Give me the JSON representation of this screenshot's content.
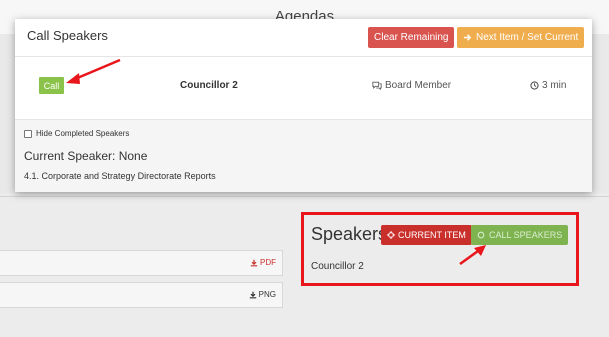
{
  "background": {
    "title": "Agendas",
    "files": [
      {
        "label": "PDF",
        "icon": "download-icon"
      },
      {
        "label": "PNG",
        "icon": "download-icon"
      }
    ]
  },
  "speakers_panel": {
    "title": "Speakers",
    "current_item_label": "CURRENT ITEM",
    "call_speakers_label": "CALL SPEAKERS",
    "speaker_name": "Councillor 2"
  },
  "modal": {
    "title": "Call Speakers",
    "clear_label": "Clear Remaining",
    "next_label": "Next Item / Set Current",
    "speaker": {
      "call_label": "Call",
      "name": "Councillor 2",
      "role": "Board Member",
      "time": "3 min"
    },
    "hide_completed_label": "Hide Completed Speakers",
    "current_speaker": "Current Speaker: None",
    "item_description": "4.1. Corporate and Strategy Directorate Reports"
  },
  "colors": {
    "danger": "#d9534f",
    "warning": "#f0ad4e",
    "success": "#8bc34a",
    "annotation": "#e8151b"
  }
}
